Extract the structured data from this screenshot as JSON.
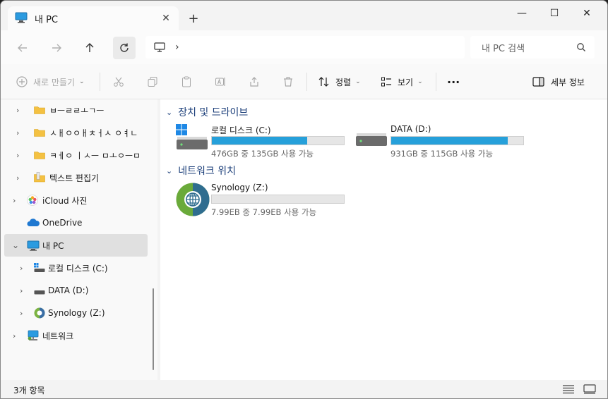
{
  "window": {
    "tab_title": "내 PC",
    "tab_close": "✕",
    "new_tab": "+",
    "minimize": "—",
    "maximize": "☐",
    "close": "✕"
  },
  "address": {
    "separator": "›",
    "search_placeholder": "내 PC 검색"
  },
  "toolbar": {
    "new_label": "새로 만들기",
    "sort_label": "정렬",
    "view_label": "보기",
    "more_label": "···",
    "details_label": "세부 정보"
  },
  "nav": {
    "items": [
      {
        "label": "ㅂㅡㄹㄹㅗㄱㅡ",
        "icon": "folder-icon"
      },
      {
        "label": "ㅅㅐㅇㅇㅐㅊㅓㅅ ㅇㅕㄴ",
        "icon": "folder-icon"
      },
      {
        "label": "ㅋㅔㅇ ㅣㅅㅡ ㅁㅗㅇㅡㅁ",
        "icon": "folder-icon"
      },
      {
        "label": "텍스트 편집기",
        "icon": "folder-icon"
      },
      {
        "label": "iCloud 사진",
        "icon": "icloud-photos-icon"
      },
      {
        "label": "OneDrive",
        "icon": "onedrive-icon"
      },
      {
        "label": "내 PC",
        "icon": "pc-icon"
      },
      {
        "label": "로컬 디스크 (C:)",
        "icon": "local-disk-icon"
      },
      {
        "label": "DATA (D:)",
        "icon": "drive-icon"
      },
      {
        "label": "Synology (Z:)",
        "icon": "network-drive-icon"
      },
      {
        "label": "네트워크",
        "icon": "network-icon"
      }
    ]
  },
  "content": {
    "devices_heading": "장치 및 드라이브",
    "network_heading": "네트워크 위치",
    "drives": [
      {
        "name": "로컬 디스크 (C:)",
        "free_text": "476GB 중 135GB 사용 가능",
        "used_fraction": 0.72
      },
      {
        "name": "DATA (D:)",
        "free_text": "931GB 중 115GB 사용 가능",
        "used_fraction": 0.88
      }
    ],
    "network_drives": [
      {
        "name": "Synology (Z:)",
        "free_text": "7.99EB 중 7.99EB 사용 가능",
        "used_fraction": 0.0
      }
    ]
  },
  "status": {
    "item_count": "3개 항목"
  },
  "colors": {
    "accent": "#26a0da",
    "section_heading": "#1c3f7a"
  }
}
